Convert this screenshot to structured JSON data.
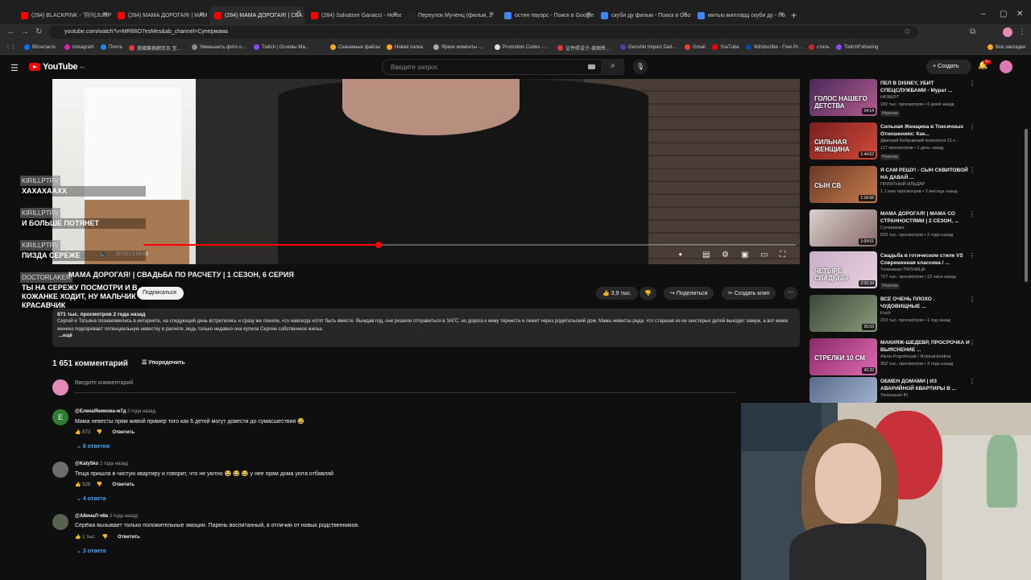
{
  "browser": {
    "tabs": [
      {
        "label": "(284) BLACKPINK - '뛰어(JUMP)",
        "fav": "#ff0000"
      },
      {
        "label": "(284) МАМА ДОРОГАЯ! | МАМ",
        "fav": "#ff0000"
      },
      {
        "label": "(284) МАМА ДОРОГАЯ! | СВА",
        "fav": "#ff0000"
      },
      {
        "label": "(284) Salvatore Ganacci - Horse",
        "fav": "#ff0000"
      },
      {
        "label": "Переулок Мученц (фильм, 2",
        "fav": "#222"
      },
      {
        "label": "остин пауэрс - Поиск в Google",
        "fav": "#4285f4"
      },
      {
        "label": "скуби ду фильм - Поиск в Goo",
        "fav": "#4285f4"
      },
      {
        "label": "мятью миллард скуби ду - По",
        "fav": "#4285f4"
      }
    ],
    "url": "youtube.com/watch?v=MR66O7esMes&ab_channel=Супермама",
    "bookmarks": [
      {
        "label": "ВКонтакте",
        "color": "#0077ff"
      },
      {
        "label": "Instagram",
        "color": "#d6249f"
      },
      {
        "label": "Почта",
        "color": "#1e88e5"
      },
      {
        "label": "美國簽務網页及 至...",
        "color": "#e53935"
      },
      {
        "label": "Уменьшить фото о...",
        "color": "#888"
      },
      {
        "label": "Twitch | Основы Ма...",
        "color": "#9146ff"
      },
      {
        "label": "Скачанные файлы",
        "color": "#f9a825"
      },
      {
        "label": "Новая папка",
        "color": "#f9a825"
      },
      {
        "label": "Яркие моменты -...",
        "color": "#aaa"
      },
      {
        "label": "Promotion Codes -...",
        "color": "#ddd"
      },
      {
        "label": "证件照设计-美图秀...",
        "color": "#e53935"
      },
      {
        "label": "Genshin Impact Dail...",
        "color": "#3949ab"
      },
      {
        "label": "Gmail",
        "color": "#ea4335"
      },
      {
        "label": "YouTube",
        "color": "#ff0000"
      },
      {
        "label": "Windscribe - Free Pr...",
        "color": "#0d47a1"
      },
      {
        "label": "стиль",
        "color": "#c62828"
      },
      {
        "label": "TwitchFollowing",
        "color": "#9146ff"
      },
      {
        "label": "Все закладки",
        "color": "#f9a825"
      }
    ]
  },
  "youtube": {
    "logo": "YouTube",
    "region": "RU",
    "search_placeholder": "Введите запрос",
    "create_label": "Создать",
    "notif_count": "9+"
  },
  "player": {
    "time": "30:19 / 1:08:59",
    "progress": 0.36
  },
  "chat": [
    {
      "nick": "KIRILLPTRV",
      "msg": "ХАХАХААХХ"
    },
    {
      "nick": "KIRILLPTRV",
      "msg": "И БОЛЬШЕ ПОТЯНЕТ"
    },
    {
      "nick": "KIRILLPTRV",
      "msg": "ПИЗДА СЕРЕЖЕ"
    },
    {
      "nick": "DOCTORLAKER",
      "msg": "ТЫ НА СЕРЕЖУ ПОСМОТРИ И В КОЖАНКЕ ХОДИТ, НУ МАЛЬЧИК КРАСАВЧИК"
    }
  ],
  "video": {
    "title": "МАМА ДОРОГАЯ! | СВАДЬБА ПО РАСЧЕТУ | 1 СЕЗОН, 6 СЕРИЯ",
    "subscribe_label": "Подписаться",
    "likes": "3,9 тыс.",
    "share_label": "Поделиться",
    "clip_label": "Создать клип",
    "views_meta": "871 тыс. просмотров  2 года назад",
    "description": "Сергей и Татьяна познакомились в интернете, на следующий день встретились и сразу же поняли, что навсегда хотят быть вместе. Выждав год, они решили отправиться в ЗАГС, но дорога к нему терниста и лежит через родительский дом. Мама невесты рада, что старшая из ее шестерых детей выходит замуж, а вот мама жениха подозревает потенциальную невестку в расчете, ведь только недавно она купила Сергею собственное жилье.",
    "more_label": "...ещё"
  },
  "comments_section": {
    "count": "1 651 комментарий",
    "sort_label": "Упорядочить",
    "add_placeholder": "Введите комментарий",
    "items": [
      {
        "avatar_letter": "E",
        "avatar_color": "#2e7d32",
        "author": "@ЕленаЯкимова-м7д",
        "time": "2 года назад",
        "text": "Мама невесты прям живой пример того как 6 детей могут довести до сумасшествия 😂",
        "likes": "873",
        "reply_label": "Ответить",
        "replies": "8 ответов"
      },
      {
        "avatar_letter": "",
        "avatar_color": "#6d6d6d",
        "author": "@Katy5ko",
        "time": "2 года назад",
        "text": "Теща пришла в чистую квартиру и говорит, что не уютно 😂 😂 😂 у нее прям дома уюта отбавляй",
        "likes": "528",
        "reply_label": "Ответить",
        "replies": "4 ответа"
      },
      {
        "avatar_letter": "",
        "avatar_color": "#55634f",
        "author": "@АйинаЛ-ч6в",
        "time": "2 года назад",
        "text": "Серёжа вызывает только положительные эмоции. Парень воспитанный, в отличии от новых родственников.",
        "likes": "1 тыс.",
        "reply_label": "Ответить",
        "replies": "3 ответа"
      }
    ]
  },
  "recommendations": [
    {
      "title": "ПЕЛ В DISNEY, УБИТ СПЕЦСЛУЖБАМИ - Мурат ...",
      "channel": "НЮБЕРГ",
      "views": "182 тыс. просмотров • 6 дней назад",
      "badge": "Новинка",
      "duration": "24:14",
      "overlay": "ГОЛОС НАШЕГО ДЕТСТВА",
      "c1": "#4a2a5a",
      "c2": "#b25a8e"
    },
    {
      "title": "Сильная Женщина в Токсичных Отношениях: Как...",
      "channel": "Дмитрий Бобровский психологи 21-г...",
      "views": "117 просмотров • 1 день назад",
      "badge": "Новинка",
      "duration": "1:44:52",
      "overlay": "СИЛЬНАЯ ЖЕНЩИНА",
      "c1": "#7a1f1f",
      "c2": "#d14a3a"
    },
    {
      "title": "Я САМ РЕШУ! - СЫН СКВИТОВОЙ НА ДАВАЙ ...",
      "channel": "ПРИЯТНЫЙ ИЛЬДАР",
      "views": "1,1 млн просмотров • 2 месяца назад",
      "badge": "",
      "duration": "1:16:56",
      "overlay": "СЫН СВ",
      "c1": "#6a3a2a",
      "c2": "#c87a4a"
    },
    {
      "title": "МАМА ДОРОГАЯ! | МАМА СО СТРАННОСТЯМИ | 2 СЕЗОН, ...",
      "channel": "Супермама",
      "views": "829 тыс. просмотров • 2 года назад",
      "badge": "",
      "duration": "1:09:51",
      "overlay": "",
      "c1": "#d8d0cc",
      "c2": "#8a6a6a"
    },
    {
      "title": "Свадьба в готическом стиле VS Современная классика / ...",
      "channel": "Телеканал ПЯТНИЦА",
      "views": "727 тыс. просмотров • 22 часа назад",
      "badge": "Новинка",
      "duration": "2:02:34",
      "overlay": "ЧЕТЫРЕ СВАДЬБЫ",
      "c1": "#c9b0c8",
      "c2": "#e8d0e0"
    },
    {
      "title": "ВСЕ ОЧЕНЬ ПЛОХО . ЧУДОВИЩНЫЕ ...",
      "channel": "Kash",
      "views": "219 тыс. просмотров • 1 год назад",
      "badge": "",
      "duration": "25:03",
      "overlay": "",
      "c1": "#3a4a3a",
      "c2": "#8a9a7a"
    },
    {
      "title": "МАКИЯЖ-ШЕДЕВР, ПРОСРОЧКА И ВЫЯСНЕНИЕ ...",
      "channel": "Alena Pogrebnyak / RobinaHoodina",
      "views": "302 тыс. просмотров • 3 года назад",
      "badge": "",
      "duration": "42:20",
      "overlay": "СТРЕЛКИ 10 СМ",
      "c1": "#8a2a6a",
      "c2": "#e06ab0"
    },
    {
      "title": "ОБМЕН ДОМАМИ | ИЗ АВАРИЙНОЙ КВАРТИРЫ В ...",
      "channel": "Телеканал Ю",
      "views": "",
      "badge": "",
      "duration": "",
      "overlay": "",
      "c1": "#5a6a8a",
      "c2": "#a0b0d0"
    }
  ]
}
